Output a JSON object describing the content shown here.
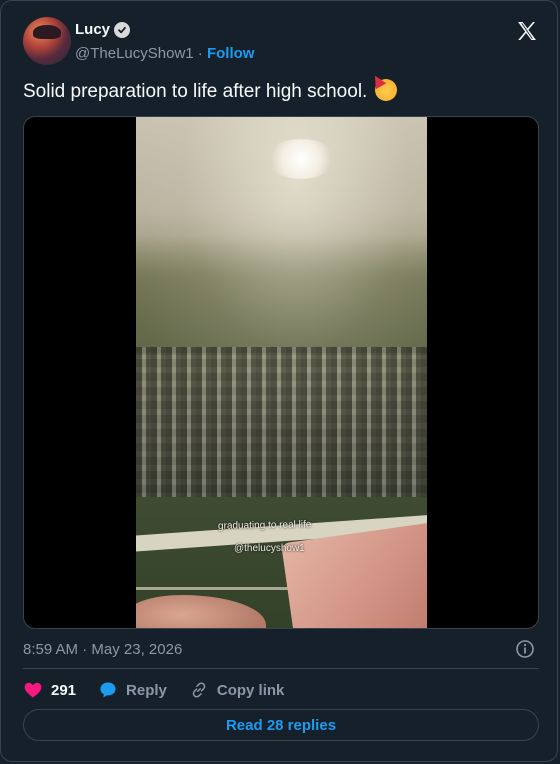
{
  "author": {
    "name": "Lucy",
    "handle": "@TheLucyShow1",
    "separator": "·",
    "follow_label": "Follow"
  },
  "tweet": {
    "text": "Solid preparation to life after high school.",
    "emoji": "party-face-emoji"
  },
  "media": {
    "overlay_line1": "graduating to real life",
    "overlay_line2": "@thelucyshow1"
  },
  "meta": {
    "time": "8:59 AM",
    "separator": "·",
    "date": "May 23, 2026"
  },
  "actions": {
    "likes_count": "291",
    "reply_label": "Reply",
    "copy_link_label": "Copy link"
  },
  "read_replies_label": "Read 28 replies",
  "icons": [
    "verified-badge-icon",
    "x-logo-icon",
    "info-icon",
    "heart-icon",
    "reply-bubble-icon",
    "link-icon"
  ],
  "colors": {
    "background": "#15202b",
    "border": "#38444d",
    "text": "#f7f9f9",
    "muted": "#8b98a5",
    "accent": "#1d9bf0",
    "like": "#f91880"
  }
}
